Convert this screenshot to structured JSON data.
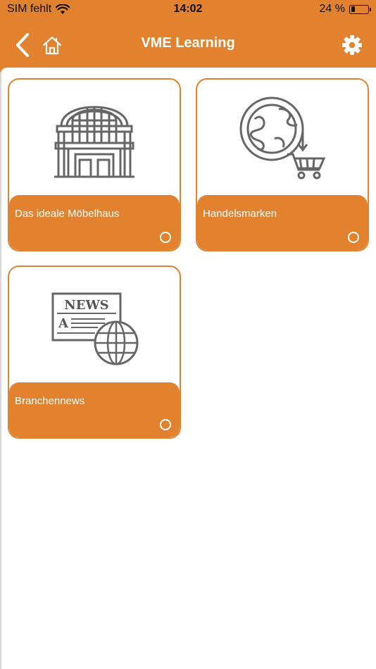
{
  "status_bar": {
    "carrier": "SIM fehlt",
    "time": "14:02",
    "battery": "24 %",
    "battery_level": 0.24
  },
  "nav": {
    "title": "VME Learning"
  },
  "tiles": [
    {
      "label": "Das ideale Möbelhaus",
      "icon": "building-icon"
    },
    {
      "label": "Handelsmarken",
      "icon": "globe-cart-icon"
    },
    {
      "label": "Branchennews",
      "icon": "newspaper-globe-icon",
      "news_text": "NEWS",
      "news_letter": "A"
    }
  ],
  "colors": {
    "accent": "#e2822f",
    "icon_gray": "#666666"
  }
}
